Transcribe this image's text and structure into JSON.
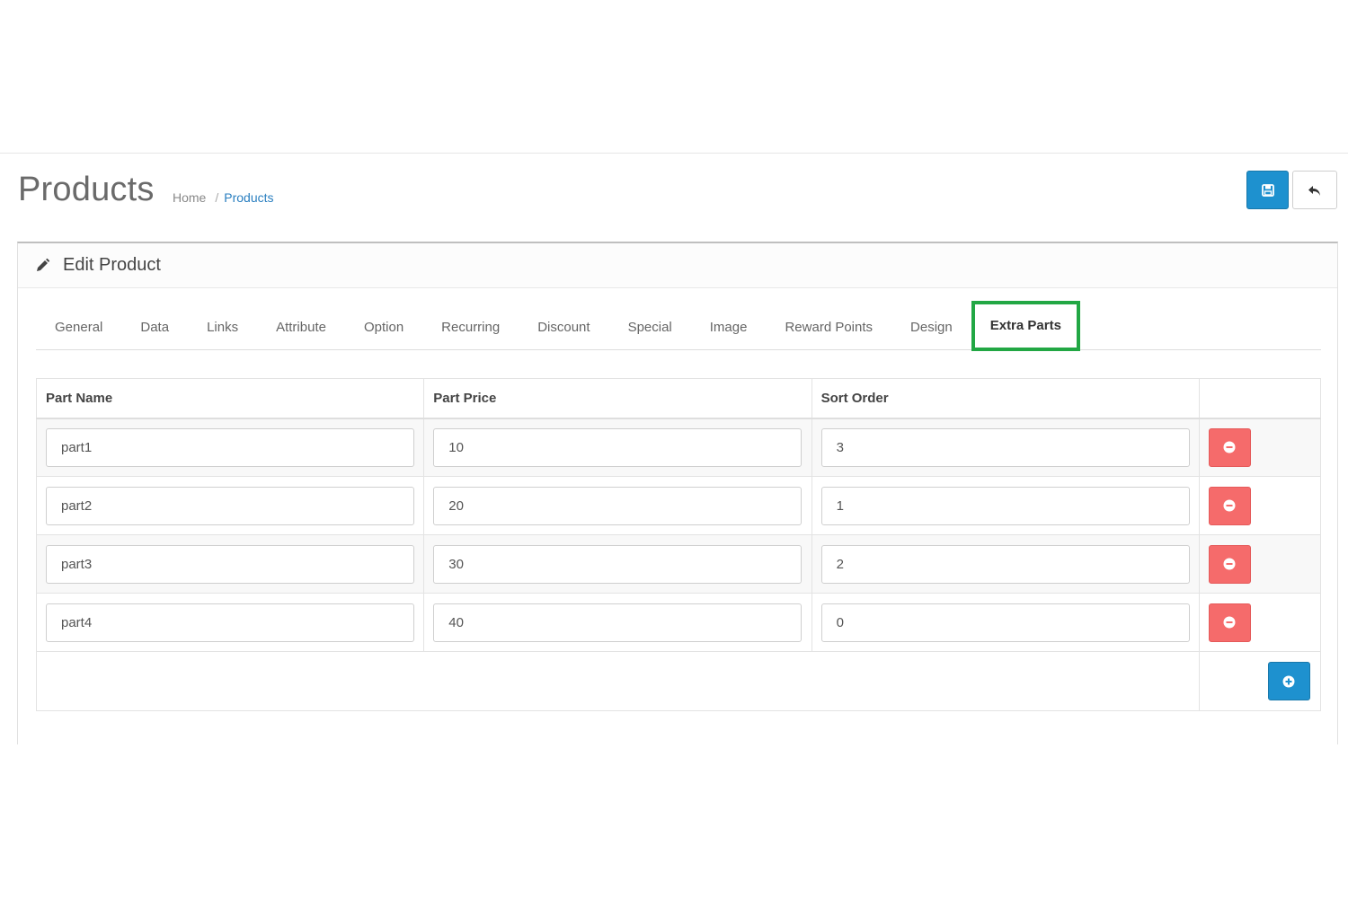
{
  "page": {
    "title": "Products",
    "breadcrumb": [
      {
        "label": "Home"
      },
      {
        "separator": "/"
      },
      {
        "label": "Products"
      }
    ]
  },
  "header_buttons": {
    "save": {
      "icon": "save-icon"
    },
    "back": {
      "icon": "reply-icon"
    }
  },
  "panel": {
    "title": "Edit Product",
    "icon": "pencil-icon"
  },
  "tabs": [
    {
      "label": "General"
    },
    {
      "label": "Data"
    },
    {
      "label": "Links"
    },
    {
      "label": "Attribute"
    },
    {
      "label": "Option"
    },
    {
      "label": "Recurring"
    },
    {
      "label": "Discount"
    },
    {
      "label": "Special"
    },
    {
      "label": "Image"
    },
    {
      "label": "Reward Points"
    },
    {
      "label": "Design"
    },
    {
      "label": "Extra Parts",
      "active": true
    }
  ],
  "table": {
    "headers": [
      "Part Name",
      "Part Price",
      "Sort Order",
      ""
    ],
    "rows": [
      {
        "name": "part1",
        "price": "10",
        "sort": "3"
      },
      {
        "name": "part2",
        "price": "20",
        "sort": "1"
      },
      {
        "name": "part3",
        "price": "30",
        "sort": "2"
      },
      {
        "name": "part4",
        "price": "40",
        "sort": "0"
      }
    ]
  },
  "colors": {
    "primary": "#1e91cf",
    "danger": "#f56b6b",
    "highlight": "#22a744"
  }
}
